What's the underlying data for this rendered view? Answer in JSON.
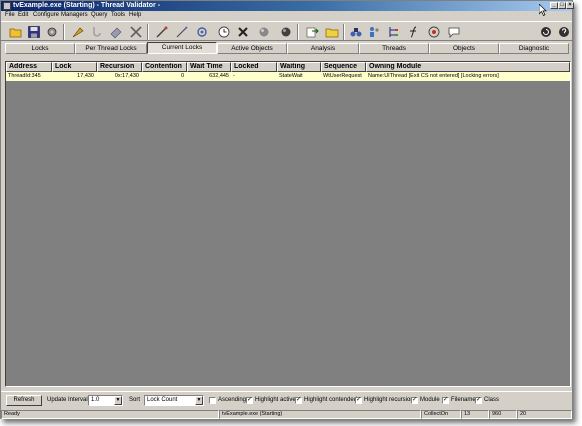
{
  "window": {
    "title": "tvExample.exe (Starting) - Thread Validator -"
  },
  "menu": [
    "File",
    "Edit",
    "Configure",
    "Managers",
    "Query",
    "Tools",
    "Help"
  ],
  "toolbar_icons": [
    "open-folder-icon",
    "save-icon",
    "settings-icon",
    "launch-icon",
    "hook-icon",
    "inject-icon",
    "stop-icon",
    "x-tool-icon",
    "wand-icon",
    "magnify-icon",
    "plug-icon",
    "clock-icon",
    "delete-x-icon",
    "sphere-icon",
    "globe-icon",
    "export-icon",
    "cut-icon",
    "folder-icon",
    "pages-icon",
    "binoculars-icon",
    "people-icon",
    "tree-icon",
    "function-icon",
    "target-icon",
    "chat-icon",
    "refresh-icon",
    "help-icon"
  ],
  "tabs": [
    {
      "label": "Locks",
      "active": false
    },
    {
      "label": "Per Thread Locks",
      "active": false
    },
    {
      "label": "Current Locks",
      "active": true
    },
    {
      "label": "Active Objects",
      "active": false
    },
    {
      "label": "Analysis",
      "active": false
    },
    {
      "label": "Threads",
      "active": false
    },
    {
      "label": "Objects",
      "active": false
    },
    {
      "label": "Diagnostic",
      "active": false
    }
  ],
  "table": {
    "columns": [
      "Address",
      "Lock",
      "Recursion",
      "Contention",
      "Wait Time",
      "Locked",
      "Waiting",
      "Sequence",
      "Owning Module"
    ],
    "rows": [
      [
        "ThreadId:345",
        "17,430",
        "0x:17,430",
        "0",
        "632,445",
        "-",
        "StateWait",
        "WtUserRequest",
        "Name:UIThread [Exit CS not entered] [Locking errors]"
      ]
    ]
  },
  "controls": {
    "refresh_label": "Refresh",
    "update_interval_label": "Update Interval",
    "update_interval_value": "1.0",
    "sort_label": "Sort",
    "sort_value": "Lock Count",
    "checkboxes": [
      {
        "label": "Ascending",
        "checked": false
      },
      {
        "label": "Highlight active",
        "checked": true
      },
      {
        "label": "Highlight contended",
        "checked": true
      },
      {
        "label": "Highlight recursion",
        "checked": true
      },
      {
        "label": "Module",
        "checked": true
      },
      {
        "label": "Filename",
        "checked": true
      },
      {
        "label": "Class",
        "checked": true
      }
    ]
  },
  "status": {
    "text": "Ready",
    "process": "tvExample.exe (Starting)",
    "collect": "CollectOn",
    "v1": "13",
    "v2": "960",
    "v3": "20"
  },
  "colors": {
    "row_highlight": "#ffffcc",
    "titlebar": "#0a246a",
    "list_bg": "#808080"
  }
}
